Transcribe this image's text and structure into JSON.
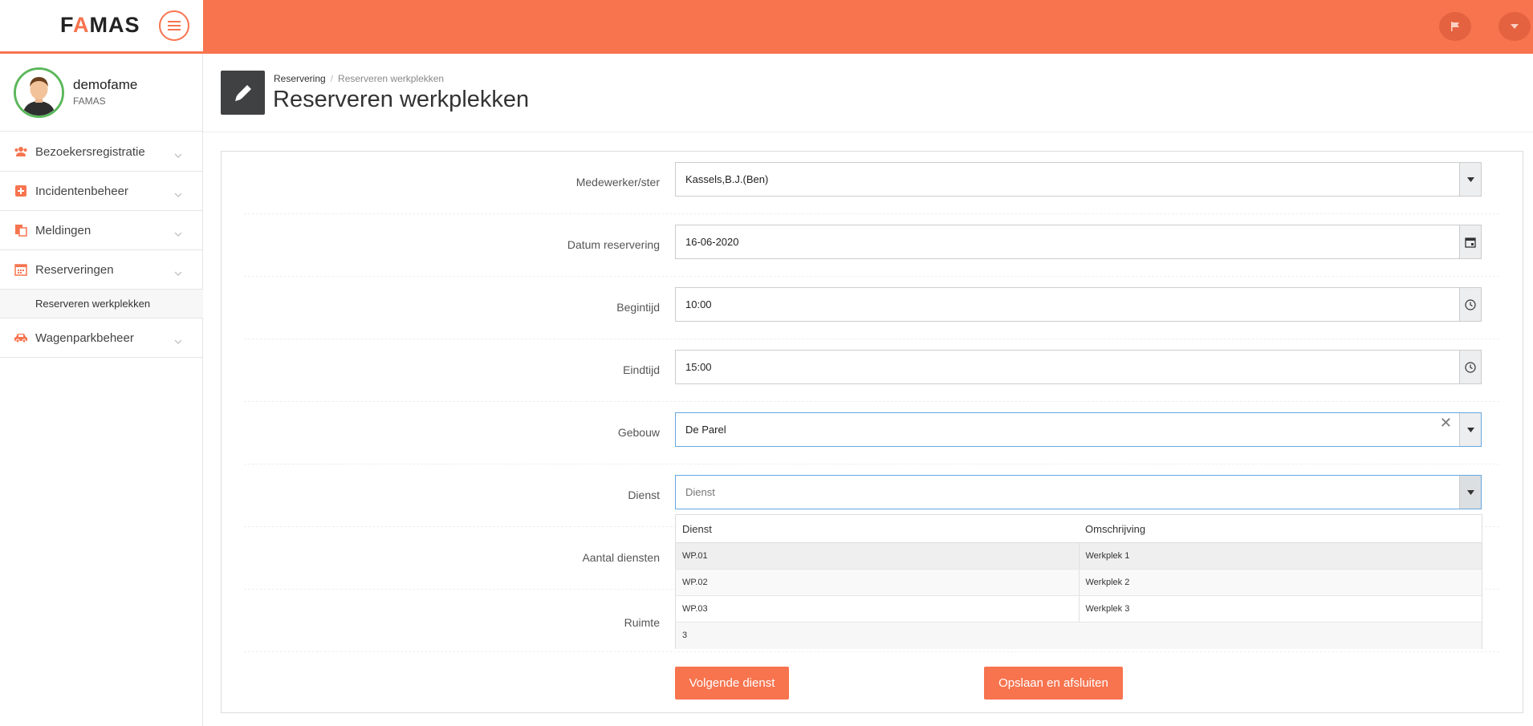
{
  "app": {
    "logo": "FAMAS",
    "accent": "#f7744f"
  },
  "user": {
    "name": "demofame",
    "org": "FAMAS"
  },
  "sidebar": {
    "items": [
      {
        "label": "Bezoekersregistratie",
        "icon": "users-icon"
      },
      {
        "label": "Incidentenbeheer",
        "icon": "plus-square-icon"
      },
      {
        "label": "Meldingen",
        "icon": "documents-icon"
      },
      {
        "label": "Reserveringen",
        "icon": "calendar-icon"
      },
      {
        "label": "Wagenparkbeheer",
        "icon": "car-icon"
      }
    ],
    "sub_item": "Reserveren werkplekken"
  },
  "header": {
    "breadcrumb": [
      "Reservering",
      "Reserveren werkplekken"
    ],
    "title": "Reserveren werkplekken"
  },
  "form": {
    "medewerker": {
      "label": "Medewerker/ster",
      "value": "Kassels,B.J.(Ben)"
    },
    "datum": {
      "label": "Datum reservering",
      "value": "16-06-2020"
    },
    "begintijd": {
      "label": "Begintijd",
      "value": "10:00"
    },
    "eindtijd": {
      "label": "Eindtijd",
      "value": "15:00"
    },
    "gebouw": {
      "label": "Gebouw",
      "value": "De Parel"
    },
    "dienst": {
      "label": "Dienst",
      "placeholder": "Dienst"
    },
    "aantal": {
      "label": "Aantal diensten"
    },
    "ruimte": {
      "label": "Ruimte"
    }
  },
  "dropdown": {
    "columns": [
      "Dienst",
      "Omschrijving"
    ],
    "rows": [
      [
        "WP.01",
        "Werkplek 1"
      ],
      [
        "WP.02",
        "Werkplek 2"
      ],
      [
        "WP.03",
        "Werkplek 3"
      ]
    ],
    "count": "3"
  },
  "buttons": {
    "next": "Volgende dienst",
    "save": "Opslaan en afsluiten"
  }
}
